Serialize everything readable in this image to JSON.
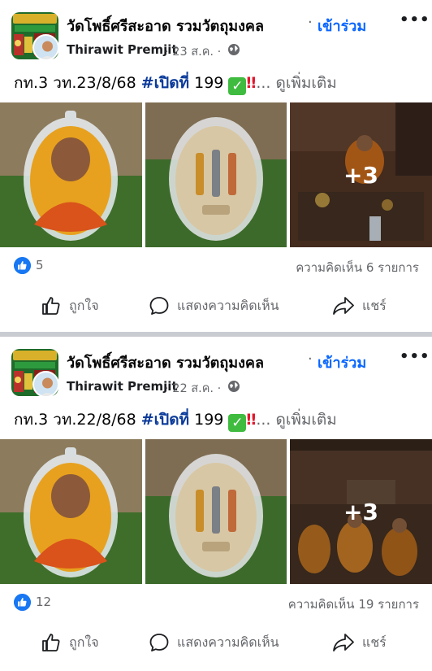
{
  "posts": [
    {
      "page_name": "วัดโพธิ์ศรีสะอาด รวมวัตถุมงคล",
      "join_label": "เข้าร่วม",
      "more_label": "•••",
      "author": "Thirawit Premjit",
      "date": "· 23 ส.ค. ·",
      "text_prefix": "กท.3  วท.23/8/68 ",
      "hashtag": "#เปิดที่",
      "text_number": " 199 ",
      "check": "✓",
      "bangs": "‼",
      "see_more": "... ดูเพิ่มเติม",
      "more_photos": "+3",
      "like_count": "5",
      "comment_count": "ความคิดเห็น 6 รายการ",
      "actions": {
        "like": "ถูกใจ",
        "comment": "แสดงความคิดเห็น",
        "share": "แชร์"
      }
    },
    {
      "page_name": "วัดโพธิ์ศรีสะอาด รวมวัตถุมงคล",
      "join_label": "เข้าร่วม",
      "more_label": "•••",
      "author": "Thirawit Premjit",
      "date": "· 22 ส.ค. ·",
      "text_prefix": "กท.3  วท.22/8/68 ",
      "hashtag": "#เปิดที่",
      "text_number": " 199 ",
      "check": "✓",
      "bangs": "‼",
      "see_more": "... ดูเพิ่มเติม",
      "more_photos": "+3",
      "like_count": "12",
      "comment_count": "ความคิดเห็น 19 รายการ",
      "actions": {
        "like": "ถูกใจ",
        "comment": "แสดงความคิดเห็น",
        "share": "แชร์"
      }
    }
  ],
  "colors": {
    "accent": "#0866ff",
    "like_blue": "#1877f2",
    "hashtag": "#0a3a9a",
    "muted": "#65676b",
    "separator": "#c9ccd1"
  },
  "icons": [
    "globe-icon",
    "like-reaction-icon",
    "thumbs-up-icon",
    "comment-bubble-icon",
    "share-arrow-icon",
    "more-icon"
  ]
}
